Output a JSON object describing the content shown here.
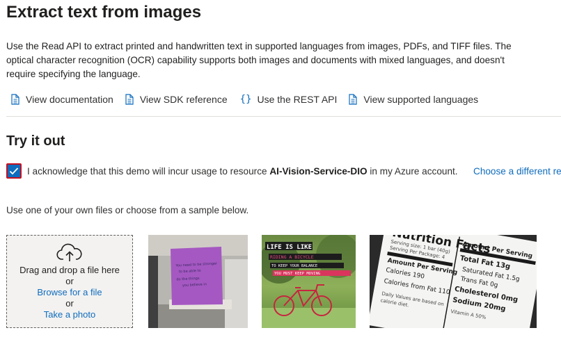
{
  "page": {
    "title": "Extract text from images",
    "description": "Use the Read API to extract printed and handwritten text in supported languages from images, PDFs, and TIFF files. The optical character recognition (OCR) capability supports both images and documents with mixed languages, and doesn't require specifying the language."
  },
  "links": [
    {
      "label": "View documentation",
      "icon": "document-icon"
    },
    {
      "label": "View SDK reference",
      "icon": "document-icon"
    },
    {
      "label": "Use the REST API",
      "icon": "braces-icon"
    },
    {
      "label": "View supported languages",
      "icon": "document-icon"
    }
  ],
  "try_it": {
    "title": "Try it out",
    "ack_prefix": "I acknowledge that this demo will incur usage to resource ",
    "resource_name": "AI-Vision-Service-DIO",
    "ack_suffix": " in my Azure account.",
    "ack_checked": true,
    "choose_link": "Choose a different re",
    "instruction": "Use one of your own files or choose from a sample below."
  },
  "dropzone": {
    "drag_text": "Drag and drop a file here",
    "or1": "or",
    "browse_link": "Browse for a file",
    "or2": "or",
    "photo_link": "Take a photo"
  },
  "samples": {
    "note_text": [
      "You need to be stronger",
      "to be able to",
      "do the things",
      "you believe in"
    ],
    "poster_lines": [
      "LIFE IS LIKE",
      "RIDING A BICYCLE",
      "TO KEEP YOUR BALANCE",
      "YOU MUST KEEP MOVING"
    ],
    "nutrition": {
      "title": "Nutrition Facts",
      "serving_size": "Serving size: 1 bar (40g)",
      "servings": "Serving Per Package: 4",
      "amount_per_serving": "Amount Per Serving",
      "calories": "Calories 190",
      "calories_fat": "Calories from Fat 110",
      "daily": "Daily Values are based on",
      "diet": "calorie diet.",
      "amount_header": "Amount Per Serving",
      "total_fat": "Total Fat 13g",
      "sat_fat": "Saturated Fat 1.5g",
      "trans_fat": "Trans Fat 0g",
      "cholesterol": "Cholesterol 0mg",
      "sodium": "Sodium 20mg",
      "vitamin": "Vitamin A 50%"
    }
  },
  "colors": {
    "accent": "#0f6cbd",
    "checkbox_border": "#c50f1f"
  }
}
